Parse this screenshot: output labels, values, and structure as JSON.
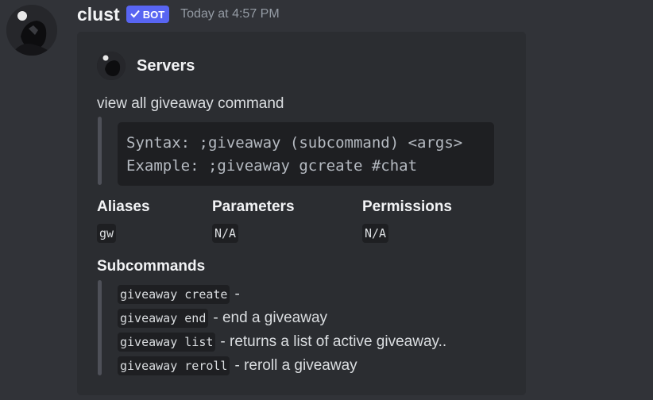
{
  "message": {
    "username": "clust",
    "bot_badge": "BOT",
    "timestamp": "Today at 4:57 PM"
  },
  "embed": {
    "author": "Servers",
    "description": "view all giveaway command",
    "syntax_lines": [
      "Syntax: ;giveaway (subcommand) <args>",
      "Example: ;giveaway gcreate #chat"
    ],
    "fields": [
      {
        "name": "Aliases",
        "value": "gw"
      },
      {
        "name": "Parameters",
        "value": "N/A"
      },
      {
        "name": "Permissions",
        "value": "N/A"
      }
    ],
    "subcommands_title": "Subcommands",
    "subcommands": [
      {
        "command": "giveaway create",
        "description": "-"
      },
      {
        "command": "giveaway end",
        "description": "- end a giveaway"
      },
      {
        "command": "giveaway list",
        "description": "- returns a list of active giveaway.."
      },
      {
        "command": "giveaway reroll",
        "description": "- reroll a giveaway"
      }
    ]
  },
  "colors": {
    "background": "#313338",
    "embed_background": "#2b2d31",
    "bot_badge": "#5865f2",
    "code_background": "#1e1f22"
  },
  "icons": [
    "user-avatar",
    "check-icon",
    "server-avatar"
  ]
}
